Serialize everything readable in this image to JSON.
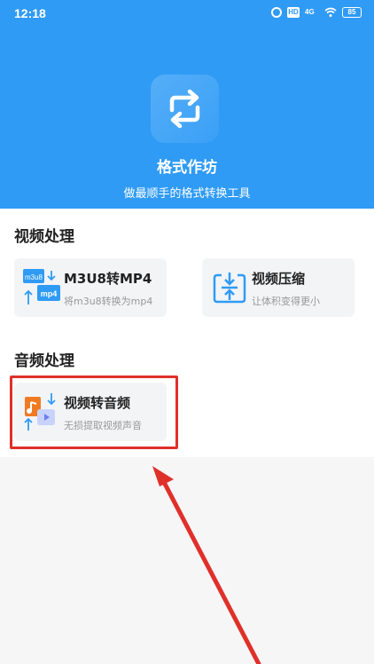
{
  "status_bar": {
    "time": "12:18",
    "network": "4G",
    "hd": "HD",
    "battery": "85"
  },
  "header": {
    "app_name": "格式作坊",
    "tagline": "做最顺手的格式转换工具",
    "background_color": "#2f9bf5",
    "logo_icon": "swap-arrows-icon"
  },
  "video_section": {
    "title": "视频处理",
    "items": [
      {
        "title": "M3U8转MP4",
        "subtitle": "将m3u8转换为mp4",
        "icon": "m3u8-mp4-convert-icon",
        "icon_labels": [
          "m3u8",
          "mp4"
        ]
      },
      {
        "title": "视频压缩",
        "subtitle": "让体积变得更小",
        "icon": "compress-icon"
      }
    ]
  },
  "audio_section": {
    "title": "音频处理",
    "items": [
      {
        "title": "视频转音频",
        "subtitle": "无损提取视频声音",
        "icon": "video-to-audio-icon"
      }
    ]
  },
  "annotation": {
    "highlight_color": "#e0302a",
    "arrow_icon": "red-arrow-pointer"
  }
}
